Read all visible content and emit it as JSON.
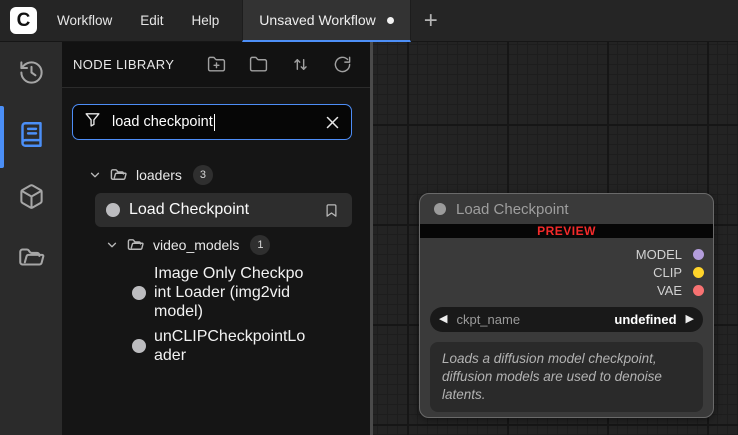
{
  "topbar": {
    "logo_letter": "C",
    "menus": {
      "workflow": "Workflow",
      "edit": "Edit",
      "help": "Help"
    },
    "tab": {
      "label": "Unsaved Workflow"
    },
    "new_tab": "+"
  },
  "node_library": {
    "title": "NODE LIBRARY",
    "search": {
      "value": "load checkpoint"
    },
    "tree": {
      "0": {
        "type": "folder",
        "label": "loaders",
        "count": "3"
      },
      "1": {
        "type": "node",
        "label": "Load Checkpoint",
        "selected": true
      },
      "2": {
        "type": "folder",
        "label": "video_models",
        "count": "1"
      },
      "3": {
        "type": "node",
        "label": "Image Only Checkpoint Loader (img2vid model)"
      },
      "4": {
        "type": "node",
        "label": "unCLIPCheckpointLoader"
      }
    }
  },
  "canvas": {
    "node": {
      "title": "Load Checkpoint",
      "badge": "PREVIEW",
      "outputs": {
        "0": {
          "label": "MODEL",
          "color": "#b39ddb"
        },
        "1": {
          "label": "CLIP",
          "color": "#ffd42a"
        },
        "2": {
          "label": "VAE",
          "color": "#f77272"
        }
      },
      "widget": {
        "prev": "◀",
        "name": "ckpt_name",
        "value": "undefined",
        "next": "▶"
      },
      "description": "Loads a diffusion model checkpoint, diffusion models are used to denoise latents."
    }
  },
  "colors": {
    "accent": "#4b8ff7",
    "preview_red": "#f42a2a"
  }
}
